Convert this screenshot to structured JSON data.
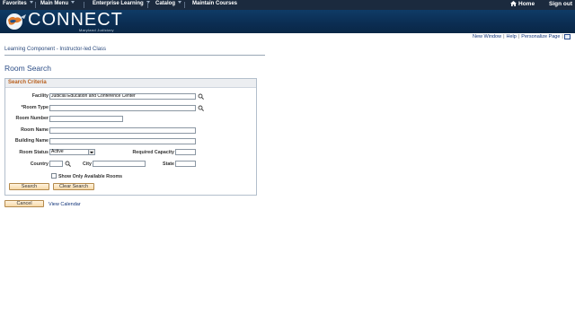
{
  "topnav": {
    "items": [
      {
        "label": "Favorites"
      },
      {
        "label": "Main Menu"
      },
      {
        "label": "Enterprise Learning"
      },
      {
        "label": "Catalog"
      },
      {
        "label": "Maintain Courses"
      }
    ],
    "home_label": "Home",
    "signout_label": "Sign out"
  },
  "banner": {
    "logo_text": "CONNECT",
    "logo_subtext": "Maryland Judiciary"
  },
  "utility": {
    "new_window": "New Window",
    "help": "Help",
    "personalize": "Personalize Page",
    "separator": "|"
  },
  "breadcrumb": "Learning Component - Instructor-led Class",
  "page_title": "Room Search",
  "search_criteria": {
    "header": "Search Criteria",
    "facility": {
      "label": "Facility",
      "value": "Judicial Education and Conference Center"
    },
    "room_type": {
      "label": "*Room Type",
      "value": ""
    },
    "room_number": {
      "label": "Room Number",
      "value": ""
    },
    "room_name": {
      "label": "Room Name",
      "value": ""
    },
    "building_name": {
      "label": "Building Name",
      "value": ""
    },
    "room_status": {
      "label": "Room Status",
      "value": "Active"
    },
    "required_capacity": {
      "label": "Required Capacity",
      "value": ""
    },
    "country": {
      "label": "Country",
      "value": ""
    },
    "city": {
      "label": "City",
      "value": ""
    },
    "state": {
      "label": "State",
      "value": ""
    },
    "show_available": {
      "label": "Show Only Available Rooms",
      "checked": false
    },
    "search_button": "Search",
    "clear_button": "Clear Search"
  },
  "cancel_button": "Cancel",
  "view_calendar": "View Calendar",
  "colors": {
    "nav_bg": "#1b2a3e",
    "banner_bg": "#0b2d52",
    "header_text": "#b85f1c",
    "link": "#11347a"
  }
}
